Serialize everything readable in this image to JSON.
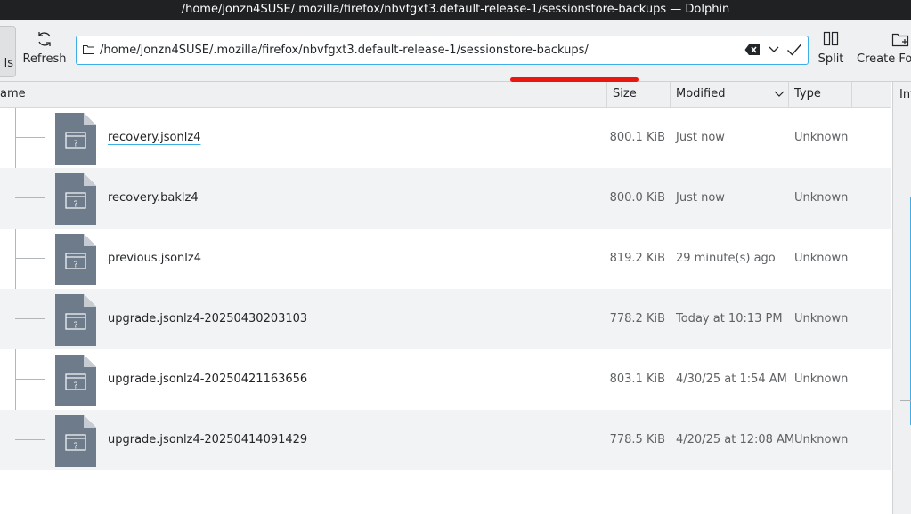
{
  "window": {
    "title": "/home/jonzn4SUSE/.mozilla/firefox/nbvfgxt3.default-release-1/sessionstore-backups — Dolphin"
  },
  "toolbar": {
    "details_label": "ls",
    "refresh_label": "Refresh",
    "split_label": "Split",
    "create_folder_label": "Create Fo",
    "location": "/home/jonzn4SUSE/.mozilla/firefox/nbvfgxt3.default-release-1/sessionstore-backups/"
  },
  "columns": {
    "name": "ame",
    "size": "Size",
    "modified": "Modified",
    "type": "Type"
  },
  "info_panel": {
    "label": "Inf"
  },
  "colors": {
    "accent": "#3daee9",
    "highlight_underline": "#e8170f",
    "titlebar": "#1f2122"
  },
  "files": [
    {
      "name": "recovery.jsonlz4",
      "size": "800.1 KiB",
      "modified": "Just now",
      "type": "Unknown",
      "icon": "unknown-file-icon"
    },
    {
      "name": "recovery.baklz4",
      "size": "800.0 KiB",
      "modified": "Just now",
      "type": "Unknown",
      "icon": "unknown-file-icon"
    },
    {
      "name": "previous.jsonlz4",
      "size": "819.2 KiB",
      "modified": "29 minute(s) ago",
      "type": "Unknown",
      "icon": "unknown-file-icon"
    },
    {
      "name": "upgrade.jsonlz4-20250430203103",
      "size": "778.2 KiB",
      "modified": "Today at 10:13 PM",
      "type": "Unknown",
      "icon": "unknown-file-icon"
    },
    {
      "name": "upgrade.jsonlz4-20250421163656",
      "size": "803.1 KiB",
      "modified": "4/30/25 at 1:54 AM",
      "type": "Unknown",
      "icon": "unknown-file-icon"
    },
    {
      "name": "upgrade.jsonlz4-20250414091429",
      "size": "778.5 KiB",
      "modified": "4/20/25 at 12:08 AM",
      "type": "Unknown",
      "icon": "unknown-file-icon"
    }
  ]
}
